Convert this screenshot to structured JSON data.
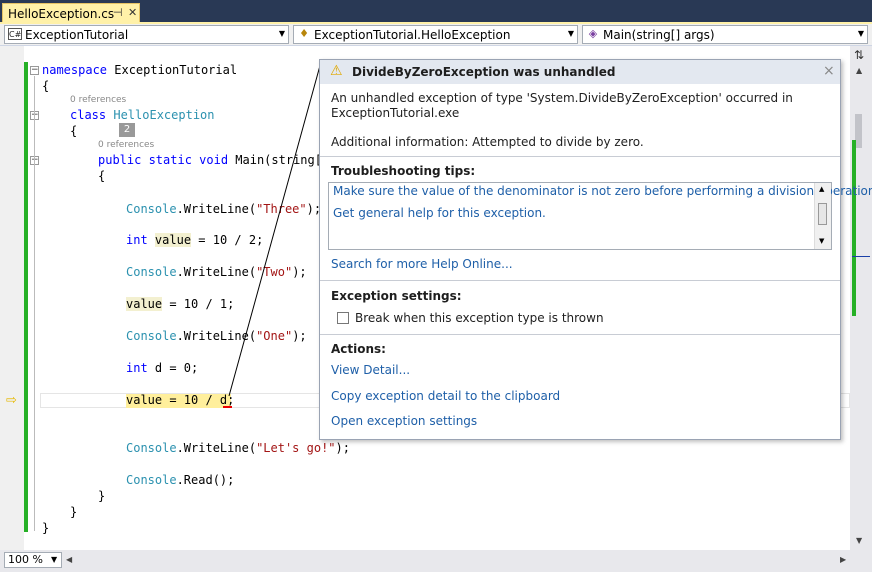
{
  "tab": {
    "label": "HelloException.cs",
    "pin": "⊣",
    "close": "✕"
  },
  "nav": {
    "project": {
      "icon": "C#",
      "label": "ExceptionTutorial"
    },
    "class": {
      "label": "ExceptionTutorial.HelloException"
    },
    "member": {
      "label": "Main(string[] args)"
    }
  },
  "code": {
    "namespace_kw": "namespace",
    "namespace_name": " ExceptionTutorial",
    "open_brace": "{",
    "refs1": "0 references",
    "class_kw": "class",
    "class_name": " HelloException",
    "class_open": "{",
    "badge": "2",
    "refs2": "0 references",
    "main_kw1": "public",
    "main_kw2": " static",
    "main_kw3": " void",
    "main_rest": " Main(string[]",
    "main_open": "{",
    "l1_console": "Console",
    "l1_rest": ".WriteLine(",
    "l1_str": "\"Three\"",
    "l1_end": ");",
    "l2_kw": "int",
    "l2_var": "value",
    "l2_rest": " = 10 / 2;",
    "l3_console": "Console",
    "l3_rest": ".WriteLine(",
    "l3_str": "\"Two\"",
    "l3_end": ");",
    "l4_var": "value",
    "l4_rest": " = 10 / 1;",
    "l5_console": "Console",
    "l5_rest": ".WriteLine(",
    "l5_str": "\"One\"",
    "l5_end": ");",
    "l6_kw": "int",
    "l6_rest": " d = 0;",
    "l7_text": "value = 10 / d;",
    "l8_console": "Console",
    "l8_rest": ".WriteLine(",
    "l8_str": "\"Let's go!\"",
    "l8_end": ");",
    "l9_console": "Console",
    "l9_rest": ".Read();",
    "main_close": "}",
    "class_close": "}",
    "ns_close": "}"
  },
  "popup": {
    "title": "DivideByZeroException was unhandled",
    "close": "×",
    "message_line1": "An unhandled exception of type 'System.DivideByZeroException' occurred in",
    "message_line2": "ExceptionTutorial.exe",
    "additional": "Additional information: Attempted to divide by zero.",
    "tips_heading": "Troubleshooting tips:",
    "tip1": "Make sure the value of the denominator is not zero before performing a division operation.",
    "tip2": "Get general help for this exception.",
    "search_link": "Search for more Help Online...",
    "settings_heading": "Exception settings:",
    "checkbox_label": "Break when this exception type is thrown",
    "checkbox_checked": false,
    "actions_heading": "Actions:",
    "action1": "View Detail...",
    "action2": "Copy exception detail to the clipboard",
    "action3": "Open exception settings"
  },
  "zoom": {
    "label": "100 %"
  },
  "colors": {
    "keyword": "#0000ff",
    "type": "#2b91af",
    "string": "#a31515",
    "link": "#1e5fa8",
    "tab": "#fff1a8",
    "changed": "#26b026"
  }
}
